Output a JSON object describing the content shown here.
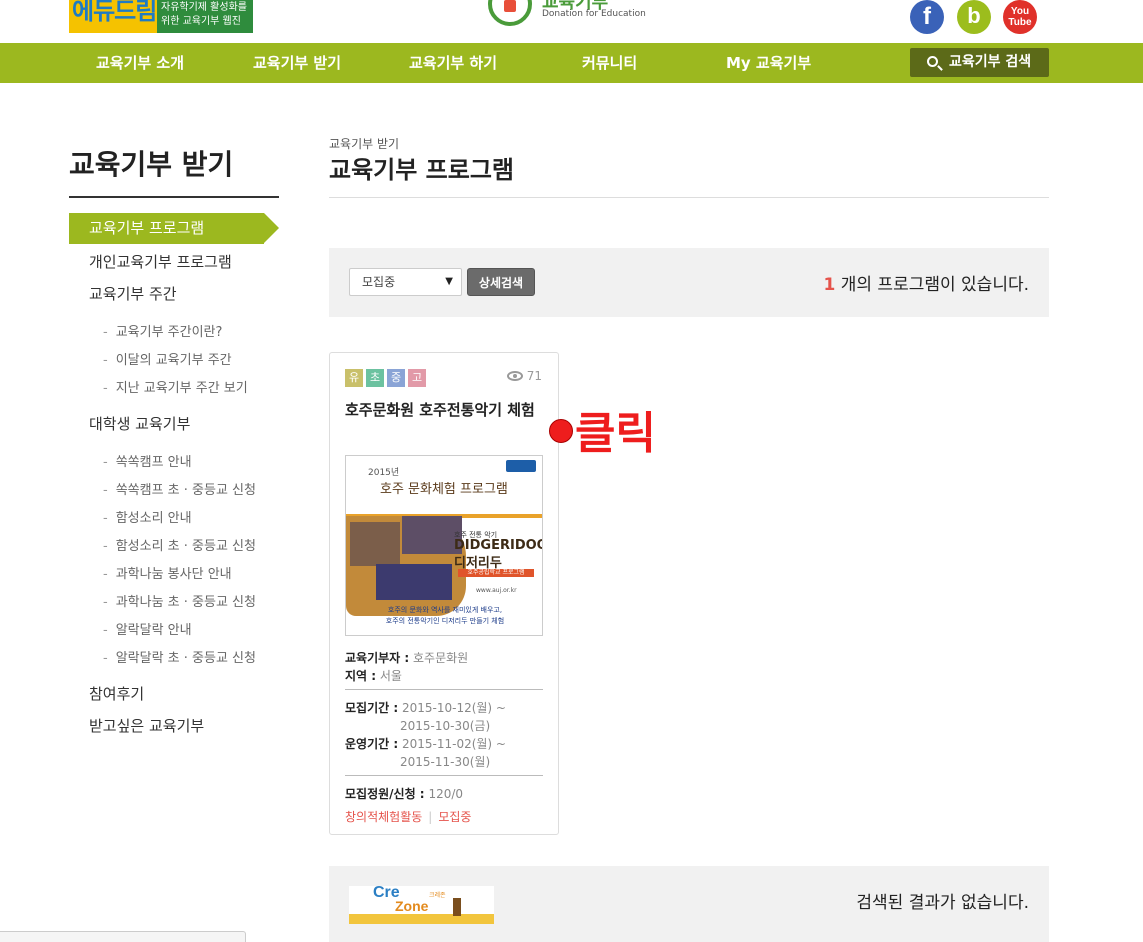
{
  "header": {
    "banner": {
      "big": "에듀드림",
      "line1": "자유학기제 활성화를",
      "line2": "위한 교육기부 웹진"
    },
    "logo": {
      "title": "교육기부",
      "subtitle": "Donation for Education"
    },
    "social": [
      {
        "name": "facebook",
        "glyph": "f"
      },
      {
        "name": "band",
        "glyph": "b"
      },
      {
        "name": "youtube",
        "glyph_line1": "You",
        "glyph_line2": "Tube"
      }
    ]
  },
  "nav": {
    "items": [
      "교육기부 소개",
      "교육기부 받기",
      "교육기부 하기",
      "커뮤니티",
      "My 교육기부"
    ],
    "search_label": "교육기부 검색",
    "color": "#9cb81f"
  },
  "sidebar": {
    "title": "교육기부 받기",
    "active": "교육기부 프로그램",
    "items": [
      {
        "label": "개인교육기부 프로그램"
      },
      {
        "label": "교육기부 주간"
      },
      {
        "label": "대학생 교육기부"
      },
      {
        "label": "참여후기"
      },
      {
        "label": "받고싶은 교육기부"
      }
    ],
    "week_sub": [
      "교육기부 주간이란?",
      "이달의 교육기부 주간",
      "지난 교육기부 주간 보기"
    ],
    "college_sub": [
      "쏙쏙캠프 안내",
      "쏙쏙캠프 초 · 중등교 신청",
      "함성소리 안내",
      "함성소리 초 · 중등교 신청",
      "과학나눔 봉사단 안내",
      "과학나눔 초 · 중등교 신청",
      "알락달락 안내",
      "알락달락 초 · 중등교 신청"
    ],
    "dash": "-"
  },
  "main": {
    "breadcrumb": "교육기부 받기",
    "title": "교육기부 프로그램",
    "filter": {
      "select_value": "모집중",
      "detail_button": "상세검색",
      "count": "1",
      "count_suffix": " 개의 프로그램이 있습니다."
    }
  },
  "card": {
    "tags": [
      {
        "label": "유",
        "color": "#c9c06a"
      },
      {
        "label": "초",
        "color": "#6cc2a0"
      },
      {
        "label": "중",
        "color": "#8aa4d6"
      },
      {
        "label": "고",
        "color": "#e29aa8"
      }
    ],
    "views": "71",
    "title": "호주문화원 호주전통악기 체험",
    "poster": {
      "year": "2015년",
      "title": "호주 문화체험 프로그램",
      "t1": "호주 전통 악기",
      "t2": "DIDGERIDOO",
      "t3": "디저리두",
      "pill": "호주공립학교 프로그램",
      "url": "www.auj.or.kr",
      "desc1": "호주의 문화와 역사를 재미있게 배우고,",
      "desc2": "호주의 전통악기인 디저리두 만들기 체험"
    },
    "donor_key": "교육기부자 :",
    "donor_value": "호주문화원",
    "region_key": "지역 :",
    "region_value": "서울",
    "recruit_key": "모집기간 :",
    "recruit_start": "2015-10-12(월) ~",
    "recruit_end": "2015-10-30(금)",
    "operate_key": "운영기간 :",
    "operate_start": "2015-11-02(월) ~",
    "operate_end": "2015-11-30(월)",
    "capacity_key": "모집정원/신청 :",
    "capacity_value": "120/0",
    "category": "창의적체험활동",
    "status": "모집중"
  },
  "annotation": {
    "label": "클릭"
  },
  "result": {
    "logo_text1": "Cre",
    "logo_text2": "Zone",
    "logo_small": "크레존",
    "message": "검색된 결과가 없습니다."
  }
}
